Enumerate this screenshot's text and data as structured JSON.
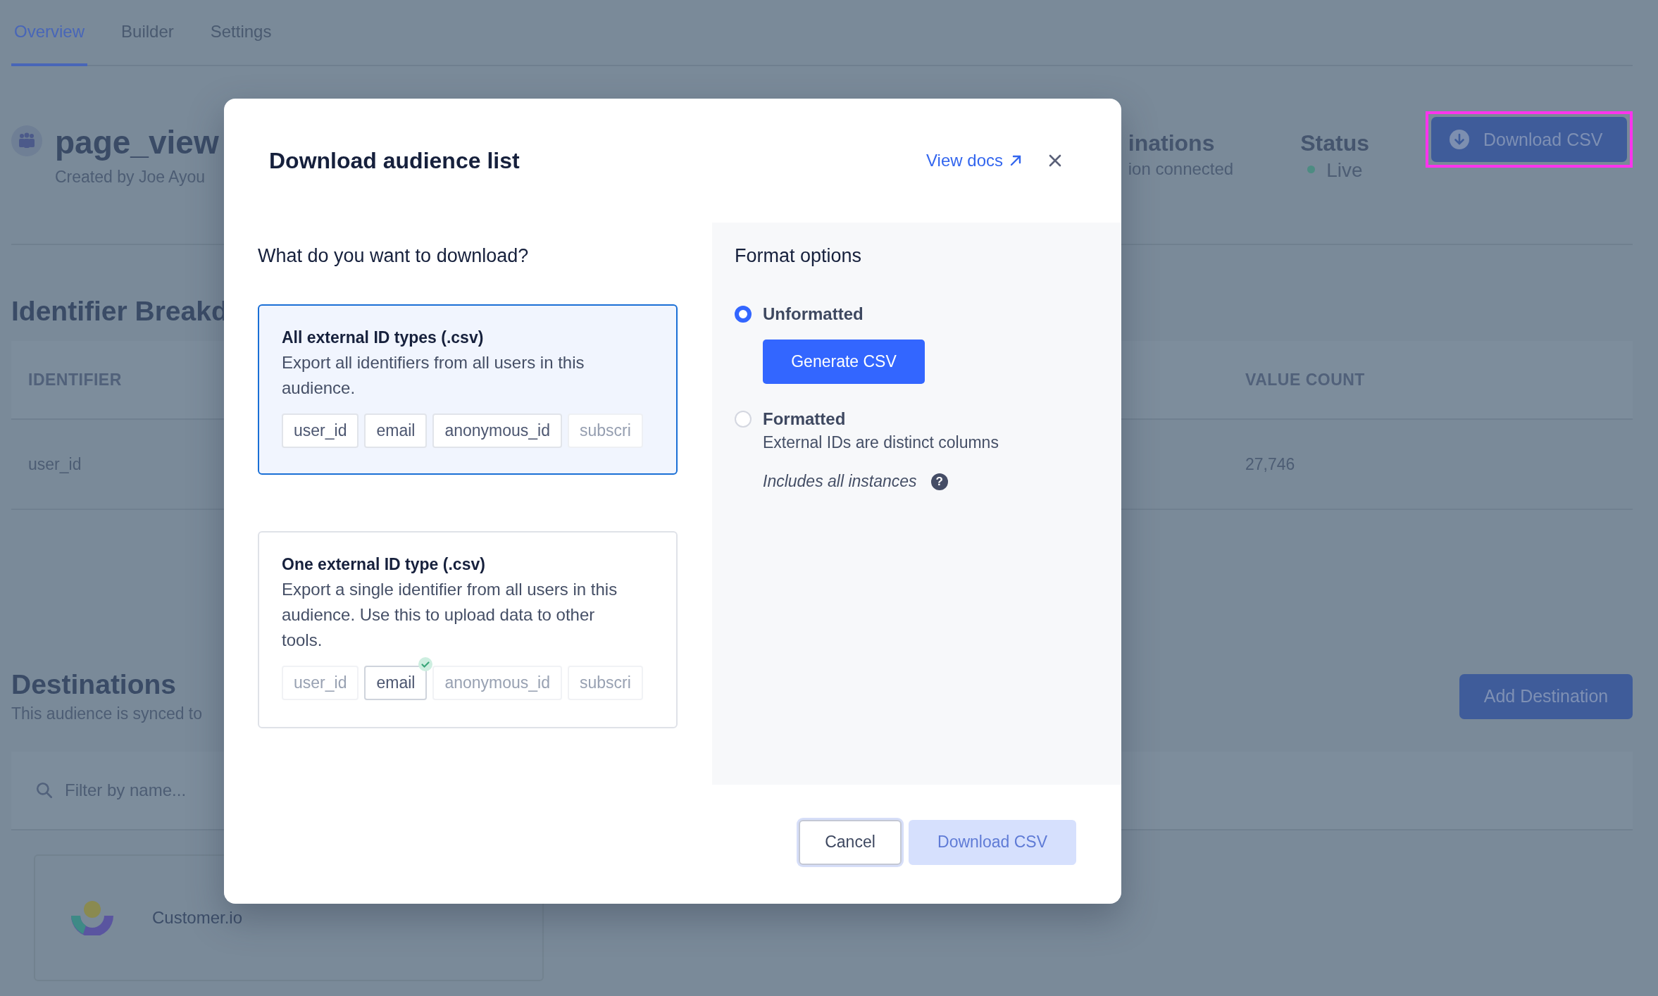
{
  "tabs": [
    {
      "label": "Overview",
      "selected": true
    },
    {
      "label": "Builder",
      "selected": false
    },
    {
      "label": "Settings",
      "selected": false
    }
  ],
  "audience": {
    "name": "page_view",
    "created_by": "Created by Joe Ayou"
  },
  "stats": [
    {
      "title": "inations",
      "value": "ion connected",
      "kind": "text"
    },
    {
      "title": "Status",
      "value": "Live",
      "kind": "status"
    }
  ],
  "header_button": {
    "label": "Download CSV",
    "highlighted": true
  },
  "identifier_section": {
    "title": "Identifier Breakd",
    "columns": [
      "IDENTIFIER",
      "VALUE COUNT"
    ],
    "rows": [
      [
        "user_id",
        "27,746"
      ]
    ]
  },
  "destinations": {
    "title": "Destinations",
    "subtitle": "This audience is synced to",
    "button": "Add Destination",
    "filter_placeholder": "Filter by name...",
    "items": [
      {
        "name": "Customer.io"
      }
    ]
  },
  "modal": {
    "title": "Download audience list",
    "docs_link": "View docs",
    "question": "What do you want to download?",
    "options": [
      {
        "kind": "all",
        "title": "All external ID types (.csv)",
        "description": "Export all identifiers from all users in this audience.",
        "selected": true,
        "chips": [
          {
            "label": "user_id"
          },
          {
            "label": "email"
          },
          {
            "label": "anonymous_id"
          },
          {
            "label": "subscri"
          }
        ]
      },
      {
        "kind": "one",
        "title": "One external ID type (.csv)",
        "description": "Export a single identifier from all users in this audience. Use this to upload data to other tools.",
        "selected": false,
        "chips": [
          {
            "label": "user_id",
            "selected": false
          },
          {
            "label": "email",
            "selected": true
          },
          {
            "label": "anonymous_id",
            "selected": false
          },
          {
            "label": "subscri",
            "selected": false
          }
        ]
      }
    ],
    "format_title": "Format options",
    "formats": [
      {
        "label": "Unformatted",
        "selected": true,
        "action": "Generate CSV"
      },
      {
        "label": "Formatted",
        "selected": false,
        "description": "External IDs are distinct columns",
        "note": "Includes all instances",
        "help": "?"
      }
    ],
    "buttons": [
      {
        "label": "Cancel",
        "kind": "secondary",
        "disabled": false,
        "focused": true
      },
      {
        "label": "Download CSV",
        "kind": "primary",
        "disabled": true,
        "focused": false
      }
    ]
  }
}
